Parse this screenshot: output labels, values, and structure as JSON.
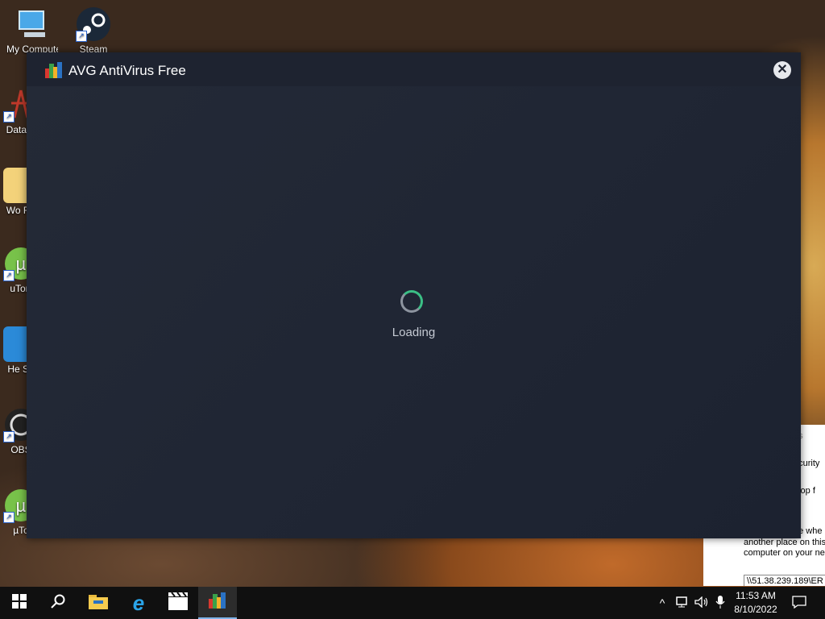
{
  "desktop": {
    "icons": [
      {
        "label": "My Computer",
        "icon": "computer-icon"
      },
      {
        "label": "Steam",
        "icon": "steam-icon"
      },
      {
        "label": "DataW",
        "icon": "datawrapper-icon"
      },
      {
        "label": "Wo Ro",
        "icon": "folder-icon"
      },
      {
        "label": "uTorr",
        "icon": "utorrent-icon"
      },
      {
        "label": "He Sh",
        "icon": "app-icon"
      },
      {
        "label": "OBS",
        "icon": "obs-icon"
      },
      {
        "label": "µTo",
        "icon": "utorrent-icon"
      }
    ]
  },
  "background_window": {
    "lines": [
      "es",
      "ecurity",
      "ktop f",
      "ge whe",
      "another place on this",
      "computer on your net",
      "\\\\51.38.239.189\\ER"
    ]
  },
  "avg_window": {
    "title": "AVG AntiVirus Free",
    "close_label": "✕",
    "loading_text": "Loading"
  },
  "taskbar": {
    "apps": [
      "start",
      "search",
      "file-explorer",
      "internet-explorer",
      "media",
      "avg"
    ],
    "tray_chevron": "^",
    "time": "11:53 AM",
    "date": "8/10/2022"
  },
  "colors": {
    "window_bg": "#222836",
    "titlebar_bg": "#1e2330",
    "spinner_accent": "#3bbf85",
    "taskbar_bg": "#101010"
  }
}
